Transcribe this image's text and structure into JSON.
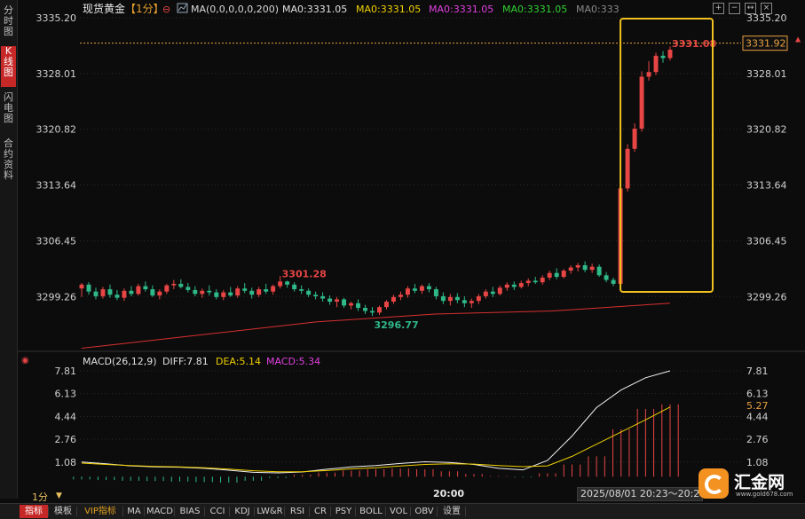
{
  "sidebar": {
    "tabs": [
      {
        "label": "分时图",
        "active": false
      },
      {
        "label": "K线图",
        "active": true
      },
      {
        "label": "闪电图",
        "active": false
      },
      {
        "label": "合约资料",
        "active": false
      }
    ]
  },
  "header": {
    "symbol": "现货黄金",
    "period_tag": "【1分】",
    "minus_glyph": "⊖",
    "ma_label": "MA(0,0,0,0,0,200)",
    "ma_values": [
      {
        "text": "MA0:3331.05",
        "color": "#e0e0e0"
      },
      {
        "text": "MA0:3331.05",
        "color": "#f0d000"
      },
      {
        "text": "MA0:3331.05",
        "color": "#e040e0"
      },
      {
        "text": "MA0:3331.05",
        "color": "#30d030"
      },
      {
        "text": "MA0:333",
        "color": "#888888"
      }
    ],
    "controls": [
      "+",
      "−",
      "↔",
      "×"
    ]
  },
  "chart_data": [
    {
      "type": "candlestick",
      "title": "现货黄金 1分",
      "y_ticks": [
        "3335.20",
        "3328.01",
        "3320.82",
        "3313.64",
        "3306.45",
        "3299.26"
      ],
      "ylim": [
        3292.2,
        3335.2
      ],
      "x_tick_labels": [
        "20:00"
      ],
      "last_price_label": "3331.92",
      "last_price": 3331.92,
      "high_annotation": {
        "text": "3331.08",
        "value": 3331.08
      },
      "local_high_annotation": {
        "text": "3301.28",
        "value": 3301.28
      },
      "local_low_annotation": {
        "text": "3296.77",
        "value": 3296.77
      },
      "ma200_series_color": "#d83030",
      "ma200_values": [
        3292.6,
        3294.3,
        3296.0,
        3297.0,
        3297.4,
        3298.4
      ],
      "candles": [
        {
          "o": 3300.3,
          "h": 3301.0,
          "l": 3299.2,
          "c": 3300.8
        },
        {
          "o": 3300.8,
          "h": 3301.1,
          "l": 3299.5,
          "c": 3299.9
        },
        {
          "o": 3299.9,
          "h": 3300.4,
          "l": 3298.9,
          "c": 3299.3
        },
        {
          "o": 3299.3,
          "h": 3300.5,
          "l": 3299.0,
          "c": 3300.2
        },
        {
          "o": 3300.2,
          "h": 3300.8,
          "l": 3299.1,
          "c": 3299.5
        },
        {
          "o": 3299.5,
          "h": 3300.1,
          "l": 3298.8,
          "c": 3299.1
        },
        {
          "o": 3299.1,
          "h": 3300.3,
          "l": 3298.7,
          "c": 3300.0
        },
        {
          "o": 3300.0,
          "h": 3300.6,
          "l": 3299.3,
          "c": 3299.6
        },
        {
          "o": 3299.6,
          "h": 3300.9,
          "l": 3299.4,
          "c": 3300.6
        },
        {
          "o": 3300.6,
          "h": 3301.2,
          "l": 3299.9,
          "c": 3300.2
        },
        {
          "o": 3300.2,
          "h": 3300.7,
          "l": 3299.2,
          "c": 3299.4
        },
        {
          "o": 3299.4,
          "h": 3300.2,
          "l": 3298.9,
          "c": 3299.9
        },
        {
          "o": 3299.9,
          "h": 3300.9,
          "l": 3299.6,
          "c": 3300.7
        },
        {
          "o": 3300.7,
          "h": 3301.4,
          "l": 3300.2,
          "c": 3300.9
        },
        {
          "o": 3300.9,
          "h": 3301.5,
          "l": 3300.3,
          "c": 3300.5
        },
        {
          "o": 3300.5,
          "h": 3301.0,
          "l": 3299.8,
          "c": 3300.1
        },
        {
          "o": 3300.1,
          "h": 3300.6,
          "l": 3299.3,
          "c": 3299.6
        },
        {
          "o": 3299.6,
          "h": 3300.3,
          "l": 3299.1,
          "c": 3300.0
        },
        {
          "o": 3300.0,
          "h": 3300.7,
          "l": 3299.4,
          "c": 3299.8
        },
        {
          "o": 3299.8,
          "h": 3300.2,
          "l": 3298.9,
          "c": 3299.2
        },
        {
          "o": 3299.2,
          "h": 3300.1,
          "l": 3298.8,
          "c": 3299.8
        },
        {
          "o": 3299.8,
          "h": 3300.5,
          "l": 3299.2,
          "c": 3299.4
        },
        {
          "o": 3299.4,
          "h": 3300.6,
          "l": 3299.1,
          "c": 3300.3
        },
        {
          "o": 3300.3,
          "h": 3301.0,
          "l": 3299.7,
          "c": 3300.0
        },
        {
          "o": 3300.0,
          "h": 3300.4,
          "l": 3299.0,
          "c": 3299.5
        },
        {
          "o": 3299.5,
          "h": 3300.5,
          "l": 3299.2,
          "c": 3300.2
        },
        {
          "o": 3300.2,
          "h": 3300.9,
          "l": 3299.6,
          "c": 3299.9
        },
        {
          "o": 3299.9,
          "h": 3300.8,
          "l": 3299.5,
          "c": 3300.6
        },
        {
          "o": 3300.6,
          "h": 3301.9,
          "l": 3300.3,
          "c": 3301.2
        },
        {
          "o": 3301.2,
          "h": 3301.3,
          "l": 3300.4,
          "c": 3300.8
        },
        {
          "o": 3300.8,
          "h": 3301.1,
          "l": 3299.9,
          "c": 3300.2
        },
        {
          "o": 3300.2,
          "h": 3300.7,
          "l": 3299.6,
          "c": 3300.0
        },
        {
          "o": 3300.0,
          "h": 3300.3,
          "l": 3299.2,
          "c": 3299.5
        },
        {
          "o": 3299.5,
          "h": 3299.9,
          "l": 3298.9,
          "c": 3299.3
        },
        {
          "o": 3299.3,
          "h": 3299.8,
          "l": 3298.6,
          "c": 3299.0
        },
        {
          "o": 3299.0,
          "h": 3299.4,
          "l": 3298.2,
          "c": 3298.6
        },
        {
          "o": 3298.6,
          "h": 3299.2,
          "l": 3297.9,
          "c": 3298.9
        },
        {
          "o": 3298.9,
          "h": 3299.1,
          "l": 3297.8,
          "c": 3298.1
        },
        {
          "o": 3298.1,
          "h": 3298.6,
          "l": 3297.6,
          "c": 3298.4
        },
        {
          "o": 3298.4,
          "h": 3298.9,
          "l": 3297.4,
          "c": 3297.8
        },
        {
          "o": 3297.8,
          "h": 3298.2,
          "l": 3297.0,
          "c": 3297.4
        },
        {
          "o": 3297.4,
          "h": 3297.9,
          "l": 3296.77,
          "c": 3297.2
        },
        {
          "o": 3297.2,
          "h": 3298.1,
          "l": 3296.9,
          "c": 3297.9
        },
        {
          "o": 3297.9,
          "h": 3298.8,
          "l": 3297.6,
          "c": 3298.6
        },
        {
          "o": 3298.6,
          "h": 3299.5,
          "l": 3298.3,
          "c": 3299.2
        },
        {
          "o": 3299.2,
          "h": 3299.9,
          "l": 3298.8,
          "c": 3299.5
        },
        {
          "o": 3299.5,
          "h": 3300.6,
          "l": 3299.1,
          "c": 3300.3
        },
        {
          "o": 3300.3,
          "h": 3300.9,
          "l": 3299.7,
          "c": 3300.0
        },
        {
          "o": 3300.0,
          "h": 3300.8,
          "l": 3299.6,
          "c": 3300.6
        },
        {
          "o": 3300.6,
          "h": 3301.0,
          "l": 3299.8,
          "c": 3300.2
        },
        {
          "o": 3300.2,
          "h": 3300.5,
          "l": 3298.9,
          "c": 3299.3
        },
        {
          "o": 3299.3,
          "h": 3299.8,
          "l": 3298.3,
          "c": 3298.7
        },
        {
          "o": 3298.7,
          "h": 3299.6,
          "l": 3298.1,
          "c": 3299.2
        },
        {
          "o": 3299.2,
          "h": 3299.7,
          "l": 3298.4,
          "c": 3298.8
        },
        {
          "o": 3298.8,
          "h": 3299.3,
          "l": 3297.9,
          "c": 3298.4
        },
        {
          "o": 3298.4,
          "h": 3299.0,
          "l": 3297.8,
          "c": 3298.7
        },
        {
          "o": 3298.7,
          "h": 3299.6,
          "l": 3298.3,
          "c": 3299.3
        },
        {
          "o": 3299.3,
          "h": 3300.2,
          "l": 3299.0,
          "c": 3299.9
        },
        {
          "o": 3299.9,
          "h": 3300.5,
          "l": 3299.2,
          "c": 3299.6
        },
        {
          "o": 3299.6,
          "h": 3300.7,
          "l": 3299.4,
          "c": 3300.4
        },
        {
          "o": 3300.4,
          "h": 3301.1,
          "l": 3300.0,
          "c": 3300.8
        },
        {
          "o": 3300.8,
          "h": 3301.2,
          "l": 3300.1,
          "c": 3300.5
        },
        {
          "o": 3300.5,
          "h": 3301.3,
          "l": 3300.3,
          "c": 3301.0
        },
        {
          "o": 3301.0,
          "h": 3301.6,
          "l": 3300.6,
          "c": 3301.3
        },
        {
          "o": 3301.3,
          "h": 3301.8,
          "l": 3300.9,
          "c": 3301.1
        },
        {
          "o": 3301.1,
          "h": 3302.0,
          "l": 3300.8,
          "c": 3301.7
        },
        {
          "o": 3301.7,
          "h": 3302.6,
          "l": 3301.4,
          "c": 3302.3
        },
        {
          "o": 3302.3,
          "h": 3302.9,
          "l": 3301.5,
          "c": 3301.8
        },
        {
          "o": 3301.8,
          "h": 3302.8,
          "l": 3301.6,
          "c": 3302.6
        },
        {
          "o": 3302.6,
          "h": 3303.3,
          "l": 3302.2,
          "c": 3303.0
        },
        {
          "o": 3303.0,
          "h": 3303.6,
          "l": 3302.5,
          "c": 3303.3
        },
        {
          "o": 3303.3,
          "h": 3303.8,
          "l": 3302.4,
          "c": 3302.7
        },
        {
          "o": 3302.7,
          "h": 3303.5,
          "l": 3302.3,
          "c": 3303.1
        },
        {
          "o": 3303.1,
          "h": 3303.4,
          "l": 3301.8,
          "c": 3302.0
        },
        {
          "o": 3302.0,
          "h": 3302.4,
          "l": 3301.1,
          "c": 3301.4
        },
        {
          "o": 3301.4,
          "h": 3301.7,
          "l": 3300.6,
          "c": 3300.9
        },
        {
          "o": 3300.9,
          "h": 3313.6,
          "l": 3300.3,
          "c": 3313.2
        },
        {
          "o": 3313.2,
          "h": 3318.9,
          "l": 3312.8,
          "c": 3318.3
        },
        {
          "o": 3318.3,
          "h": 3321.6,
          "l": 3317.9,
          "c": 3320.9
        },
        {
          "o": 3320.9,
          "h": 3328.3,
          "l": 3320.5,
          "c": 3327.6
        },
        {
          "o": 3327.6,
          "h": 3329.6,
          "l": 3327.1,
          "c": 3328.2
        },
        {
          "o": 3328.2,
          "h": 3330.7,
          "l": 3327.8,
          "c": 3330.3
        },
        {
          "o": 3330.3,
          "h": 3330.9,
          "l": 3329.4,
          "c": 3330.0
        },
        {
          "o": 3330.0,
          "h": 3331.5,
          "l": 3329.7,
          "c": 3331.08
        }
      ]
    },
    {
      "type": "macd",
      "title": "MACD(26,12,9)",
      "diff_label": "DIFF:7.81",
      "dea_label": "DEA:5.14",
      "macd_label": "MACD:5.34",
      "y_ticks": [
        "7.81",
        "6.13",
        "4.44",
        "2.76",
        "1.08"
      ],
      "current_label": "5.27",
      "ylim": [
        -0.7,
        7.81
      ],
      "diff_series": [
        1.08,
        0.95,
        0.8,
        0.72,
        0.7,
        0.62,
        0.48,
        0.32,
        0.28,
        0.35,
        0.55,
        0.72,
        0.82,
        0.98,
        1.1,
        1.05,
        0.9,
        0.62,
        0.5,
        1.2,
        3.0,
        5.1,
        6.4,
        7.3,
        7.81
      ],
      "dea_series": [
        1.0,
        0.9,
        0.82,
        0.76,
        0.72,
        0.66,
        0.56,
        0.44,
        0.36,
        0.36,
        0.45,
        0.58,
        0.66,
        0.79,
        0.9,
        0.95,
        0.93,
        0.82,
        0.74,
        0.8,
        1.5,
        2.4,
        3.3,
        4.2,
        5.14
      ],
      "histogram": [
        -0.2,
        -0.25,
        -0.3,
        -0.32,
        -0.36,
        -0.4,
        -0.44,
        -0.3,
        -0.1,
        0.15,
        0.3,
        0.45,
        0.55,
        0.6,
        0.55,
        0.4,
        0.2,
        0.05,
        -0.05,
        0.25,
        0.9,
        1.5,
        3.5,
        5.0,
        5.34
      ]
    }
  ],
  "footer": {
    "period": "1分",
    "x_time_label": "20:00",
    "timestamp": "2025/08/01 20:23～20:2",
    "logo_name": "汇金网",
    "logo_url": "www.gold678.com",
    "tabs": [
      {
        "label": "指标",
        "selected": true,
        "vip": false
      },
      {
        "label": "模板",
        "selected": false,
        "vip": false
      },
      {
        "label": "VIP指标",
        "selected": false,
        "vip": true
      },
      {
        "label": "MA",
        "selected": false,
        "vip": false
      },
      {
        "label": "MACD",
        "selected": false,
        "vip": false
      },
      {
        "label": "BIAS",
        "selected": false,
        "vip": false
      },
      {
        "label": "CCI",
        "selected": false,
        "vip": false
      },
      {
        "label": "KDJ",
        "selected": false,
        "vip": false
      },
      {
        "label": "LW&R",
        "selected": false,
        "vip": false
      },
      {
        "label": "RSI",
        "selected": false,
        "vip": false
      },
      {
        "label": "CR",
        "selected": false,
        "vip": false
      },
      {
        "label": "PSY",
        "selected": false,
        "vip": false
      },
      {
        "label": "BOLL",
        "selected": false,
        "vip": false
      },
      {
        "label": "VOL",
        "selected": false,
        "vip": false
      },
      {
        "label": "OBV",
        "selected": false,
        "vip": false
      },
      {
        "label": "设置",
        "selected": false,
        "vip": false
      }
    ]
  },
  "colors": {
    "up": "#e84545",
    "down": "#2fb989",
    "grid": "#2a2a2a",
    "axis_text": "#d0d0d0",
    "highlight_box": "#f0c020",
    "price_line": "#e8a040"
  }
}
